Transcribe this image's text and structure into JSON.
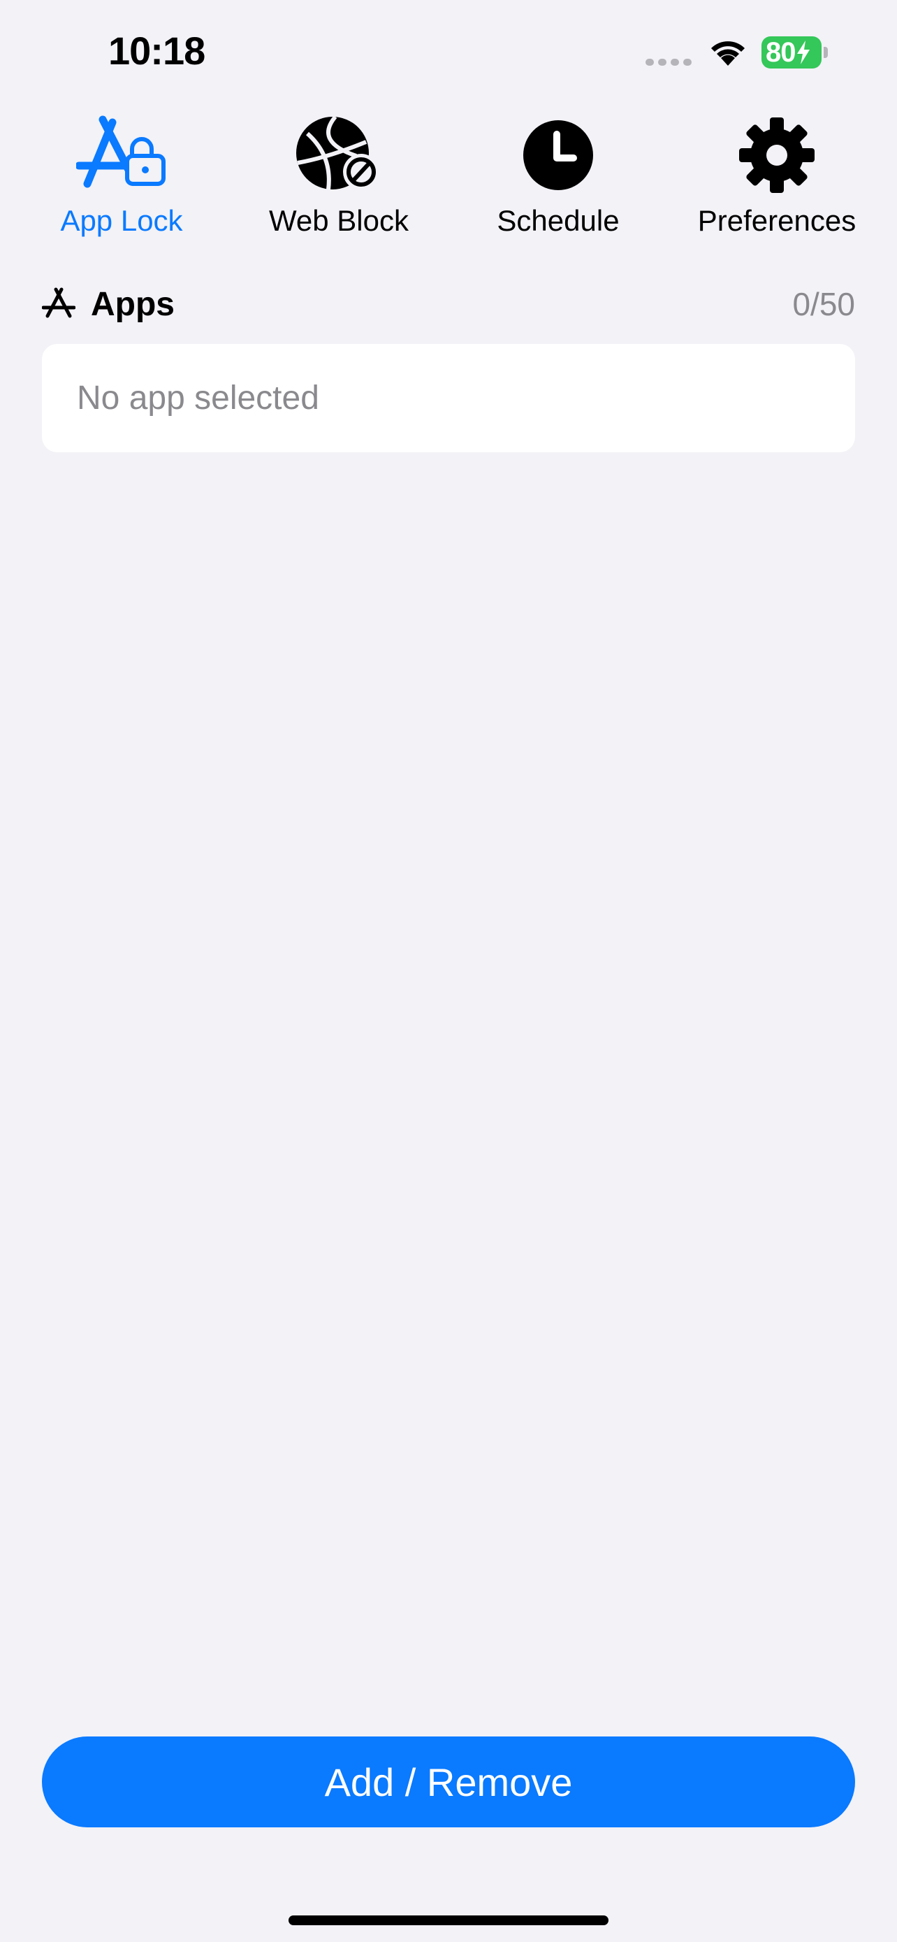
{
  "status_bar": {
    "time": "10:18",
    "battery_level": "80",
    "battery_color": "#34c759"
  },
  "tabs": [
    {
      "label": "App Lock",
      "icon": "app-lock-icon",
      "active": true
    },
    {
      "label": "Web Block",
      "icon": "web-block-icon",
      "active": false
    },
    {
      "label": "Schedule",
      "icon": "clock-icon",
      "active": false
    },
    {
      "label": "Preferences",
      "icon": "gear-icon",
      "active": false
    }
  ],
  "apps_section": {
    "title": "Apps",
    "count": "0/50",
    "empty_text": "No app selected"
  },
  "primary_button": {
    "label": "Add / Remove"
  },
  "colors": {
    "accent": "#0a7aff",
    "background": "#f2f2f7",
    "secondary_text": "#8a8a8e"
  }
}
